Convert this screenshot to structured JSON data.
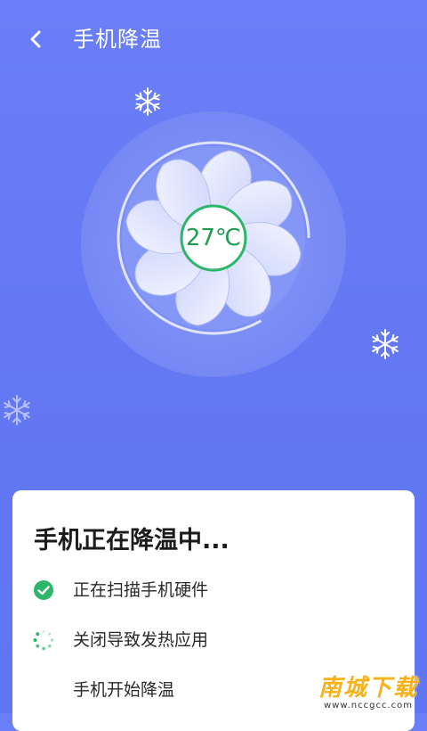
{
  "header": {
    "back_icon": "chevron-left-icon",
    "title": "手机降温"
  },
  "fan": {
    "temperature": "27℃",
    "icon": "fan-icon",
    "colors": {
      "ring": "#7d8ff6",
      "blades": "#e3e8fd",
      "temp_border": "#28b06a",
      "temp_text": "#1f9a52"
    }
  },
  "decorations": {
    "snowflake_icon": "snowflake-icon"
  },
  "card": {
    "title": "手机正在降温中...",
    "steps": [
      {
        "label": "正在扫描手机硬件",
        "status": "done",
        "icon": "check-circle-icon"
      },
      {
        "label": "关闭导致发热应用",
        "status": "in-progress",
        "icon": "spinner-icon"
      },
      {
        "label": "手机开始降温",
        "status": "pending",
        "icon": ""
      }
    ]
  },
  "watermark": {
    "main": "南城下载",
    "sub": "www.nccgcc.com"
  },
  "colors": {
    "background": "#6478f3",
    "card": "#ffffff",
    "success": "#2bb66a"
  }
}
